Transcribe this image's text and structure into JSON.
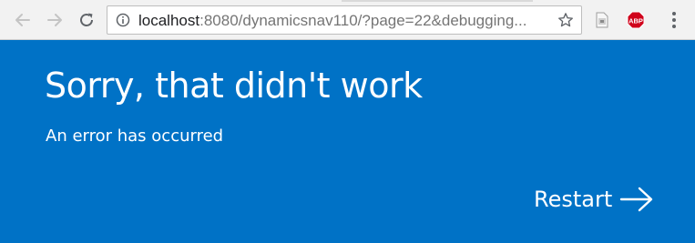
{
  "browser": {
    "url_host": "localhost",
    "url_path": ":8080/dynamicsnav110/?page=22&debugging...",
    "icons": {
      "back": "back-arrow-icon",
      "forward": "forward-arrow-icon",
      "reload": "reload-icon",
      "site_info": "info-icon",
      "bookmark": "star-icon",
      "extension": "page-extension-icon",
      "adblock": "abp-icon",
      "menu": "kebab-menu-icon"
    },
    "adblock_label": "ABP"
  },
  "page": {
    "title": "Sorry, that didn't work",
    "message": "An error has occurred",
    "restart_label": "Restart",
    "background_color": "#0072c6"
  }
}
